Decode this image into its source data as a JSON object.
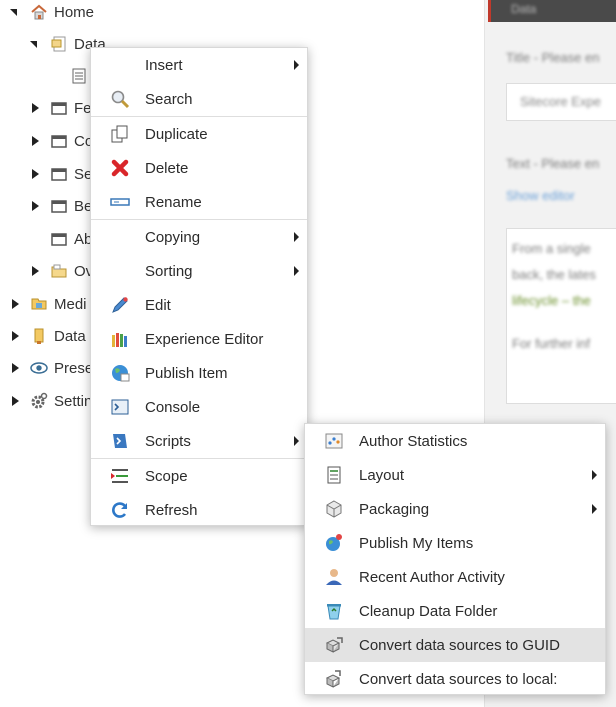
{
  "tree": {
    "home": "Home",
    "data": "Data",
    "children_partial": [
      "Fe",
      "Co",
      "Se",
      "Be",
      "Ab",
      "Ov"
    ],
    "root_partial": [
      "Medi",
      "Data",
      "Prese",
      "Settin"
    ]
  },
  "editor": {
    "header": "Data",
    "field1_label": "Title - Please en",
    "field1_value": "Sitecore Expe",
    "field2_label": "Text - Please en",
    "field2_link": "Show editor",
    "field2_lines": [
      "From a single",
      "back, the lates",
      "lifecycle – the",
      "For further inf"
    ]
  },
  "context_menu": {
    "items": [
      {
        "label": "Insert",
        "icon": "none",
        "submenu": true
      },
      {
        "label": "Search",
        "icon": "magnifier-icon"
      },
      {
        "label": "Duplicate",
        "icon": "duplicate-icon"
      },
      {
        "label": "Delete",
        "icon": "delete-x-icon"
      },
      {
        "label": "Rename",
        "icon": "rename-icon"
      },
      {
        "label": "Copying",
        "icon": "none",
        "submenu": true
      },
      {
        "label": "Sorting",
        "icon": "none",
        "submenu": true
      },
      {
        "label": "Edit",
        "icon": "pencil-icon"
      },
      {
        "label": "Experience Editor",
        "icon": "crayons-icon"
      },
      {
        "label": "Publish Item",
        "icon": "globe-icon"
      },
      {
        "label": "Console",
        "icon": "console-icon"
      },
      {
        "label": "Scripts",
        "icon": "scripts-icon",
        "submenu": true
      },
      {
        "label": "Scope",
        "icon": "scope-icon"
      },
      {
        "label": "Refresh",
        "icon": "refresh-icon"
      }
    ]
  },
  "scripts_menu": {
    "items": [
      {
        "label": "Author Statistics",
        "icon": "chart-icon"
      },
      {
        "label": "Layout",
        "icon": "layout-icon",
        "submenu": true
      },
      {
        "label": "Packaging",
        "icon": "package-icon",
        "submenu": true
      },
      {
        "label": "Publish My Items",
        "icon": "publish-globe-icon"
      },
      {
        "label": "Recent Author Activity",
        "icon": "user-icon"
      },
      {
        "label": "Cleanup Data Folder",
        "icon": "recycle-bin-icon"
      },
      {
        "label": "Convert data sources to GUID",
        "icon": "convert-icon",
        "highlighted": true
      },
      {
        "label": "Convert data sources to local:",
        "icon": "convert-local-icon"
      }
    ]
  }
}
